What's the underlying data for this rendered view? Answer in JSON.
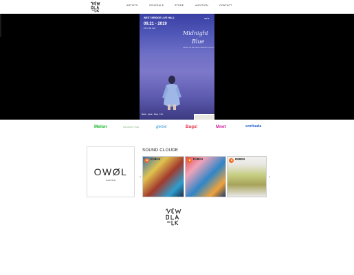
{
  "header": {
    "logo_icon": "new-black-brush-logo",
    "nav": [
      "ARTISTS",
      "SCHEDULE",
      "STORE",
      "AUDITION",
      "CONTACT"
    ]
  },
  "hero": {
    "poster": {
      "brand_line1": "WEST BRIDGE LIVE HALL",
      "brand_line2": "",
      "top_right_logo": "owl ●",
      "date": "09.21 - 2019",
      "date_sub": "PM 6:00  SAT",
      "title_line1": "Midnight",
      "title_line2": "Blue",
      "tagline": "OWOL 1st Mini Album Release Concert",
      "footer": "Melon  ·  genie  ·  Bugs  ·  FLO"
    }
  },
  "services": [
    "Melon",
    "KB MUSIC HUB",
    "genie",
    "Bugs!",
    "Mnet",
    "soribada"
  ],
  "artist_card": {
    "logo": "OWØL",
    "subtitle": "sound cloud"
  },
  "soundcloud": {
    "title": "SOUND CLOUDE",
    "tracks": [
      {
        "meta": "owol · track"
      },
      {
        "meta": "owol · track"
      },
      {
        "meta": "owol · track"
      }
    ],
    "prev_icon": "chevron-left-icon",
    "next_icon": "chevron-right-icon"
  },
  "footer": {
    "logo_icon": "new-black-brush-logo"
  },
  "colors": {
    "hero_bg": "#000000",
    "poster_blue": "#4e56b6",
    "melon": "#1fba35",
    "genie": "#3b9ad6",
    "bugs": "#e2344a",
    "mnet": "#d01ea0",
    "soribada": "#2761c9",
    "soundcloud_orange": "#f26f23"
  }
}
